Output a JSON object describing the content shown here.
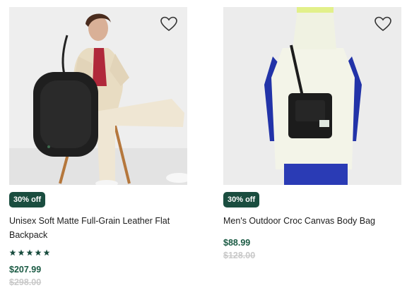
{
  "colors": {
    "brand_green": "#1a4d3f",
    "price_green": "#1a5a43",
    "strike_gray": "#c9c9c9"
  },
  "products": [
    {
      "badge": "30% off",
      "name": "Unisex Soft Matte Full-Grain Leather Flat Backpack",
      "rating": 5,
      "price": "$207.99",
      "original_price": "$298.00",
      "wishlist_icon": "heart-outline-icon"
    },
    {
      "badge": "30% off",
      "name": "Men's Outdoor Croc Canvas Body Bag",
      "price": "$88.99",
      "original_price": "$128.00",
      "wishlist_icon": "heart-outline-icon"
    }
  ]
}
